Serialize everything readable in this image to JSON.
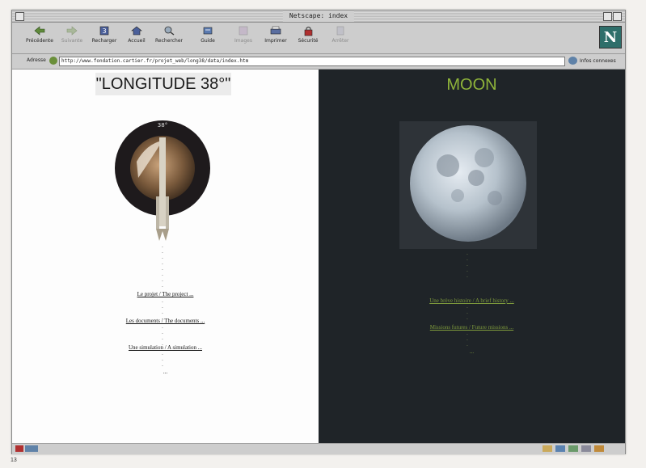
{
  "window": {
    "title": "Netscape: index"
  },
  "toolbar": {
    "buttons": [
      {
        "label": "Précédente",
        "icon": "back-arrow-icon",
        "disabled": false
      },
      {
        "label": "Suivante",
        "icon": "forward-arrow-icon",
        "disabled": true
      },
      {
        "label": "Recharger",
        "icon": "reload-icon",
        "disabled": false
      },
      {
        "label": "Accueil",
        "icon": "home-icon",
        "disabled": false
      },
      {
        "label": "Rechercher",
        "icon": "search-icon",
        "disabled": false
      },
      {
        "label": "Guide",
        "icon": "guide-icon",
        "disabled": false
      },
      {
        "label": "Images",
        "icon": "images-icon",
        "disabled": true
      },
      {
        "label": "Imprimer",
        "icon": "print-icon",
        "disabled": false
      },
      {
        "label": "Sécurité",
        "icon": "lock-icon",
        "disabled": false
      },
      {
        "label": "Arrêter",
        "icon": "stop-icon",
        "disabled": true
      }
    ]
  },
  "location": {
    "label": "Adresse",
    "url": "http://www.fondation.cartier.fr/projet_web/long38/data/index.htm",
    "infos_label": "Infos connexes"
  },
  "left_panel": {
    "title": "\"LONGITUDE 38°\"",
    "badge": "38°",
    "links": [
      "Le projet / The project ...",
      "Les documents / The documents ...",
      "Une simulation / A simulation ..."
    ],
    "end_dots": "..."
  },
  "right_panel": {
    "title": "MOON",
    "links": [
      "Une brève histoire / A brief history ...",
      "Missions futures / Future missions ..."
    ],
    "end_dots": "..."
  },
  "page_number": "13",
  "colors": {
    "moon_title": "#8fb43a",
    "right_link": "#7e9a3c",
    "right_bg": "#1f2428"
  }
}
